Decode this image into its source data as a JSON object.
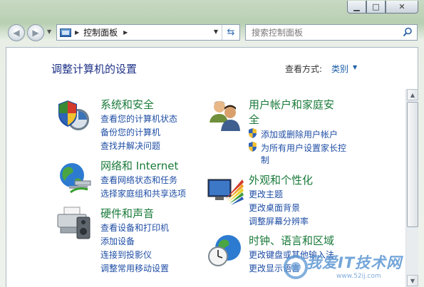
{
  "address": {
    "breadcrumb": "控制面板"
  },
  "search": {
    "placeholder": "搜索控制面板"
  },
  "main": {
    "title": "调整计算机的设置",
    "view_by_label": "查看方式:",
    "view_by_value": "类别"
  },
  "categories": {
    "system": {
      "title": "系统和安全",
      "links": [
        "查看您的计算机状态",
        "备份您的计算机",
        "查找并解决问题"
      ]
    },
    "network": {
      "title": "网络和 Internet",
      "links": [
        "查看网络状态和任务",
        "选择家庭组和共享选项"
      ]
    },
    "hardware": {
      "title": "硬件和声音",
      "links": [
        "查看设备和打印机",
        "添加设备",
        "连接到投影仪",
        "调整常用移动设置"
      ]
    },
    "users": {
      "title_line1": "用户帐户和家庭安",
      "title_line2": "全",
      "links": [
        "添加或删除用户帐户",
        "为所有用户设置家长控",
        "制"
      ]
    },
    "appearance": {
      "title": "外观和个性化",
      "links": [
        "更改主题",
        "更改桌面背景",
        "调整屏幕分辨率"
      ]
    },
    "clock": {
      "title": "时钟、语言和区域",
      "links": [
        "更改键盘或其他输入法",
        "更改显示语言"
      ]
    }
  },
  "watermark": {
    "text": "我爱IT技术网",
    "url": "www.52ij.com"
  },
  "colors": {
    "category_title": "#1a7a3a",
    "link": "#1f4ea5",
    "heading": "#1e3287"
  }
}
